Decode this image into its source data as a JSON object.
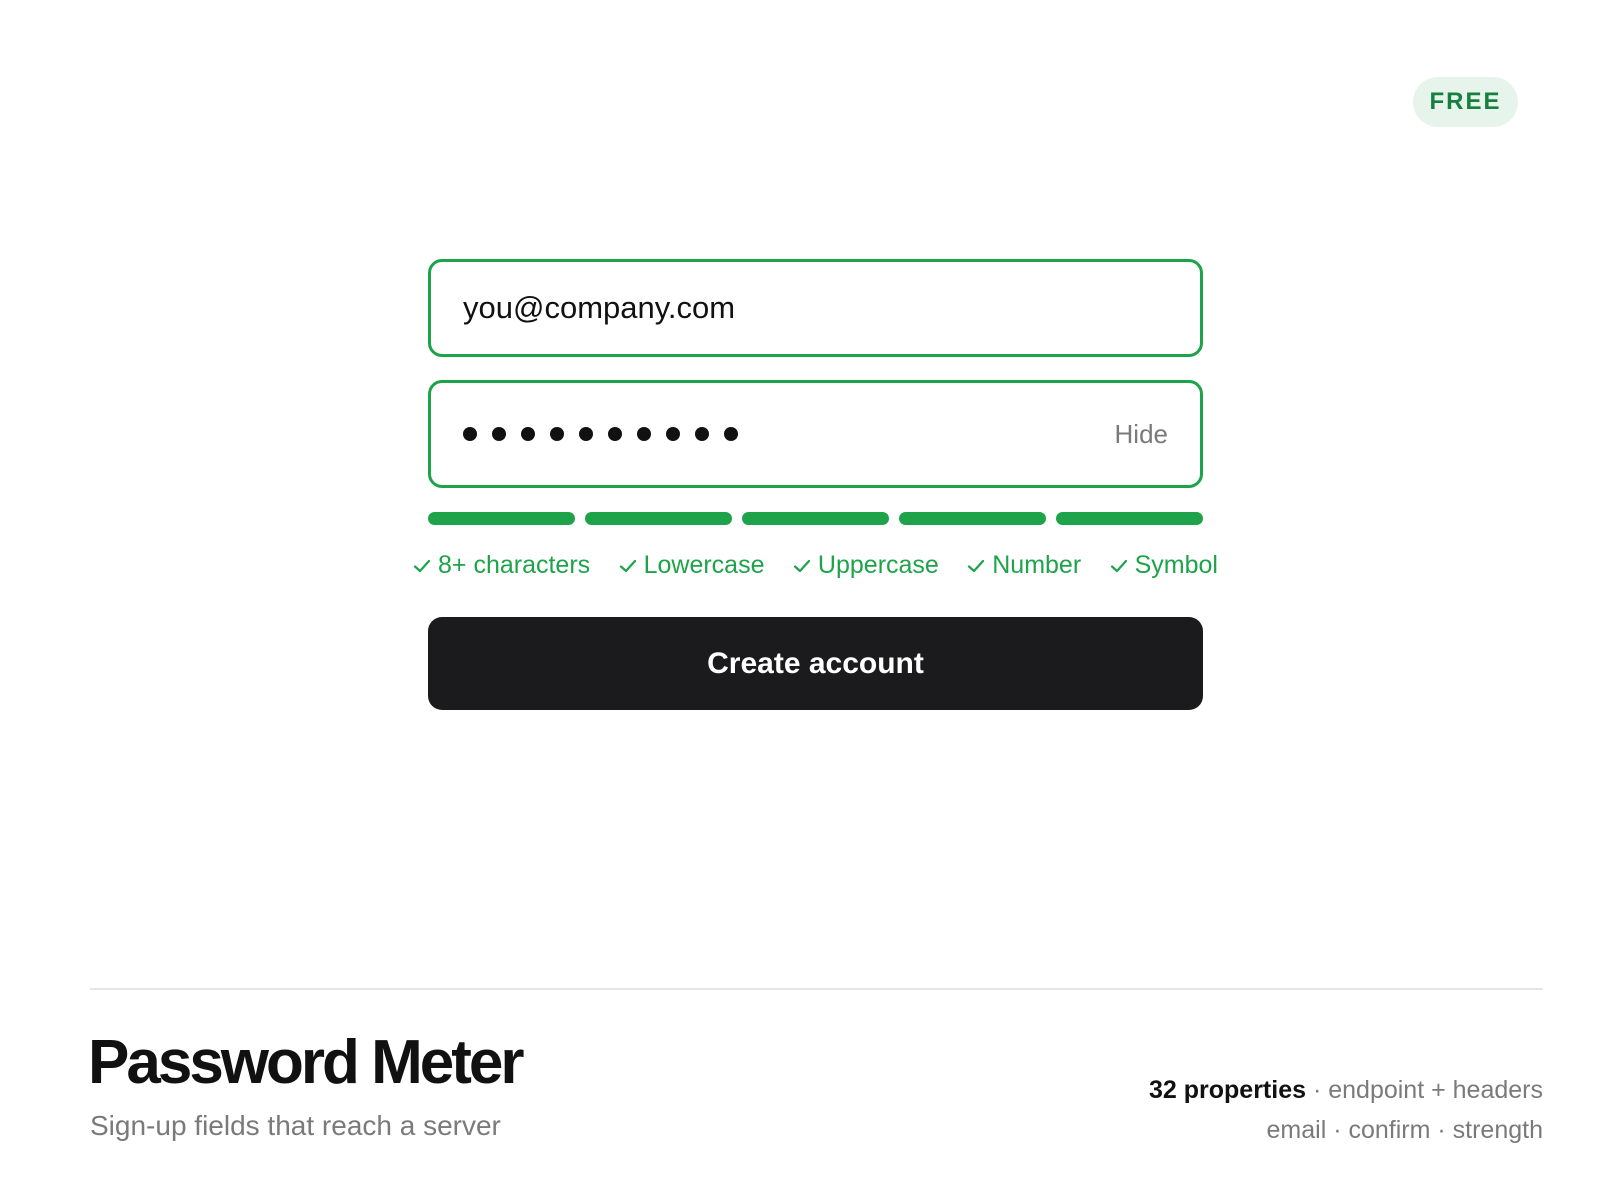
{
  "badge": {
    "label": "FREE"
  },
  "form": {
    "email": {
      "value": "you@company.com"
    },
    "password": {
      "masked_length": 10,
      "toggle_label": "Hide"
    },
    "strength": {
      "filled_segments": 5,
      "total_segments": 5,
      "color": "#1ea34a"
    },
    "requirements": [
      {
        "label": "8+ characters",
        "met": true
      },
      {
        "label": "Lowercase",
        "met": true
      },
      {
        "label": "Uppercase",
        "met": true
      },
      {
        "label": "Number",
        "met": true
      },
      {
        "label": "Symbol",
        "met": true
      }
    ],
    "submit_label": "Create account"
  },
  "footer": {
    "title": "Password Meter",
    "subtitle": "Sign-up fields that reach a server",
    "properties_count": "32 properties",
    "meta_line1_rest": " · endpoint + headers",
    "meta_line2": "email · confirm · strength"
  },
  "colors": {
    "accent": "#1ea34a",
    "button_bg": "#1b1b1d",
    "badge_bg": "#e6f4eb",
    "badge_text": "#17803f",
    "muted_text": "#7a7a7a"
  },
  "icons": {
    "requirement_met": "check-icon"
  }
}
